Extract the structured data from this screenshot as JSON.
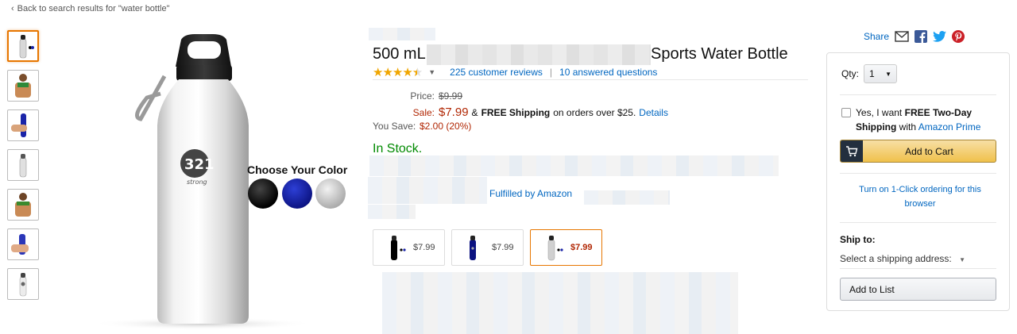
{
  "back_link": "Back to search results for \"water bottle\"",
  "product": {
    "title_start": "500 mL",
    "title_end": "Sports Water Bottle",
    "rating_stars": 4.5,
    "reviews_link": "225 customer reviews",
    "separator": "|",
    "questions_link": "10 answered questions",
    "price_label": "Price:",
    "list_price": "$9.99",
    "sale_label": "Sale:",
    "sale_price": "$7.99",
    "shipping_text_bold": "FREE Shipping",
    "shipping_amp": "&",
    "shipping_rest": "on orders over $25.",
    "details_link": "Details",
    "save_label": "You Save:",
    "save_value": "$2.00 (20%)",
    "stock": "In Stock.",
    "fulfilled": "Fulfilled by Amazon",
    "choose_color": "Choose Your Color",
    "variants": [
      {
        "color": "black",
        "price": "$7.99"
      },
      {
        "color": "blue",
        "price": "$7.99"
      },
      {
        "color": "silver",
        "price": "$7.99"
      }
    ]
  },
  "share": {
    "label": "Share"
  },
  "buybox": {
    "qty_label": "Qty:",
    "qty_value": "1",
    "prime_pre": "Yes, I want",
    "prime_bold": "FREE Two-Day Shipping",
    "prime_with": "with",
    "prime_link": "Amazon Prime",
    "add_to_cart": "Add to Cart",
    "one_click": "Turn on 1-Click ordering for this browser",
    "ship_to": "Ship to:",
    "ship_address": "Select a shipping address:",
    "add_to_list": "Add to List"
  },
  "colors": {
    "link": "#0066c0",
    "price": "#b12704",
    "in_stock": "#008a00",
    "cart_button": "#f0c14b",
    "selected_border": "#e77600",
    "black_bottle": "#000000",
    "blue_bottle": "#0b1280",
    "silver_bottle": "#c8c8c8"
  }
}
